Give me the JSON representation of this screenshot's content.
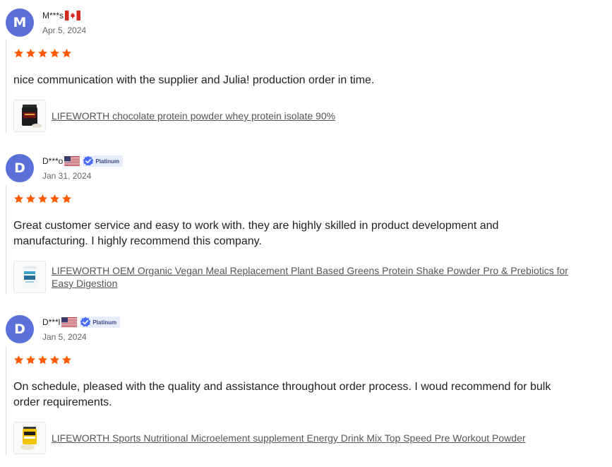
{
  "colors": {
    "avatar_bg": "#5b6fd9",
    "star": "#ff5a00",
    "badge_check": "#4a6cf7",
    "divider": "#e0e0e0",
    "link": "#555555"
  },
  "reviews": [
    {
      "avatar_letter": "M",
      "username": "M***s",
      "country_flag": "canada-flag-icon",
      "badge": null,
      "date": "Apr 5, 2024",
      "rating": 5,
      "comment": "nice communication with the supplier and Julia! production order in time.",
      "product": {
        "thumbnail": "protein-tub-black-icon",
        "link_text": "LIFEWORTH chocolate protein powder whey protein isolate 90%"
      }
    },
    {
      "avatar_letter": "D",
      "username": "D***o",
      "country_flag": "usa-flag-icon",
      "badge": "Platinum",
      "date": "Jan 31, 2024",
      "rating": 5,
      "comment": "Great customer service and easy to work with. they are highly skilled in product development and manufacturing. I highly recommend this company.",
      "product": {
        "thumbnail": "meal-shake-tub-icon",
        "link_text": "LIFEWORTH OEM Organic Vegan Meal Replacement Plant Based Greens Protein Shake Powder Pro & Prebiotics for Easy Digestion"
      }
    },
    {
      "avatar_letter": "D",
      "username": "D***l",
      "country_flag": "usa-flag-icon",
      "badge": "Platinum",
      "date": "Jan 5, 2024",
      "rating": 5,
      "comment": "On schedule, pleased with the quality and assistance throughout order process. I woud recommend for bulk order requirements.",
      "product": {
        "thumbnail": "pre-workout-tub-icon",
        "link_text": "LIFEWORTH Sports Nutritional Microelement supplement Energy Drink Mix Top Speed Pre Workout Powder"
      }
    }
  ]
}
